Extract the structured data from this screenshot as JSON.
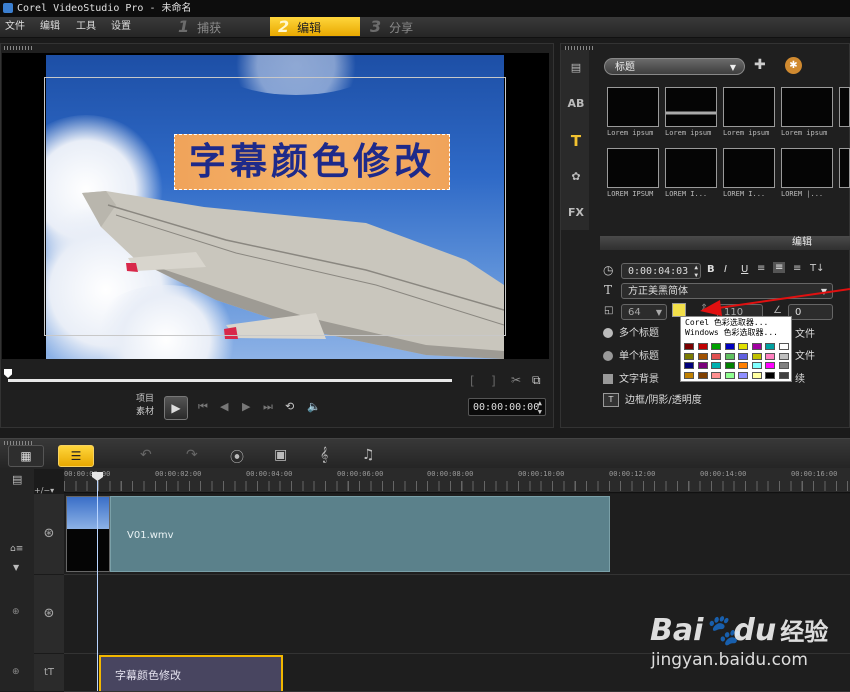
{
  "window": {
    "title": "Corel VideoStudio Pro - 未命名"
  },
  "menu": {
    "file": "文件",
    "edit": "编辑",
    "tools": "工具",
    "settings": "设置"
  },
  "steps": [
    {
      "num": "1",
      "label": "捕获"
    },
    {
      "num": "2",
      "label": "编辑"
    },
    {
      "num": "3",
      "label": "分享"
    }
  ],
  "preview": {
    "subtitle_text": "字幕颜色修改",
    "mode_project": "项目",
    "mode_clip": "素材",
    "timecode": "00:00:00:00"
  },
  "library": {
    "category": "标题",
    "thumbs_row1": [
      "Lorem ipsum",
      "Lorem ipsum",
      "Lorem ipsum",
      "Lorem ipsum"
    ],
    "thumbs_row2": [
      "LOREM IPSUM",
      "LOREM I...",
      "LOREM I...",
      "LOREM |..."
    ]
  },
  "edit": {
    "header": "编辑",
    "duration": "0:00:04:03",
    "font": "方正美黑简体",
    "font_size": "64",
    "line_spacing": "110",
    "angle": "0",
    "option_multi": "多个标题",
    "option_single": "单个标题",
    "option_text_bg": "文字背景",
    "option_border": "边框/阴影/透明度",
    "right_text_1": "文件",
    "right_text_2": "文件",
    "right_text_3": "续",
    "color_menu": [
      "Corel 色彩选取器...",
      "Windows 色彩选取器..."
    ],
    "swatch_colors": [
      "#7a0000",
      "#c00000",
      "#00a000",
      "#0000c0",
      "#e0e000",
      "#a000a0",
      "#00a0a0",
      "#ffffff",
      "#7a7a00",
      "#a05000",
      "#e05050",
      "#60c060",
      "#6060e0",
      "#c0c000",
      "#ff80c0",
      "#c0c0c0",
      "#00007a",
      "#7a007a",
      "#00b0b0",
      "#008000",
      "#ff8000",
      "#80ffff",
      "#ff00ff",
      "#808080",
      "#c08000",
      "#804000",
      "#ff9090",
      "#90ff90",
      "#9090ff",
      "#ffffa0",
      "#000000",
      "#404040"
    ]
  },
  "timeline": {
    "ticks": [
      "00:00:00:00",
      "00:00:02:00",
      "00:00:04:00",
      "00:00:06:00",
      "00:00:08:00",
      "00:00:10:00",
      "00:00:12:00",
      "00:00:14:00",
      "00:00:16:00"
    ],
    "video_clip": "V01.wmv",
    "title_clip": "字幕颜色修改"
  },
  "watermark": {
    "brand": "Bai",
    "brand2": "du",
    "cn": "经验",
    "url": "jingyan.baidu.com"
  }
}
